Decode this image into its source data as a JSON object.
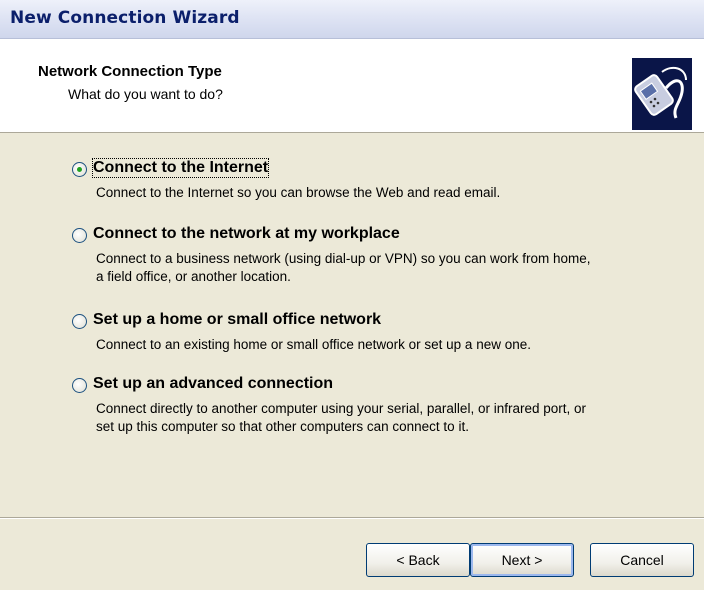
{
  "window": {
    "title": "New Connection Wizard"
  },
  "header": {
    "title": "Network Connection Type",
    "subtitle": "What do you want to do?",
    "logo_icon": "connection-wizard-icon"
  },
  "options": [
    {
      "label": "Connect to the Internet",
      "description_lines": [
        "Connect to the Internet so you can browse the Web and read email."
      ],
      "selected": true
    },
    {
      "label": "Connect to the network at my workplace",
      "description_lines": [
        "Connect to a business network (using dial-up or VPN) so you can work from home,",
        "a field office, or another location."
      ],
      "selected": false
    },
    {
      "label": "Set up a home or small office network",
      "description_lines": [
        "Connect to an existing home or small office network or set up a new one."
      ],
      "selected": false
    },
    {
      "label": "Set up an advanced connection",
      "description_lines": [
        "Connect directly to another computer using your serial, parallel, or infrared port, or",
        "set up this computer so that other computers can connect to it."
      ],
      "selected": false
    }
  ],
  "buttons": {
    "back": "< Back",
    "next": "Next >",
    "cancel": "Cancel"
  },
  "colors": {
    "title_text": "#0b1f6b",
    "dialog_bg": "#ece9d8",
    "radio_dot": "#21a121",
    "logo_bg": "#0a1548"
  }
}
